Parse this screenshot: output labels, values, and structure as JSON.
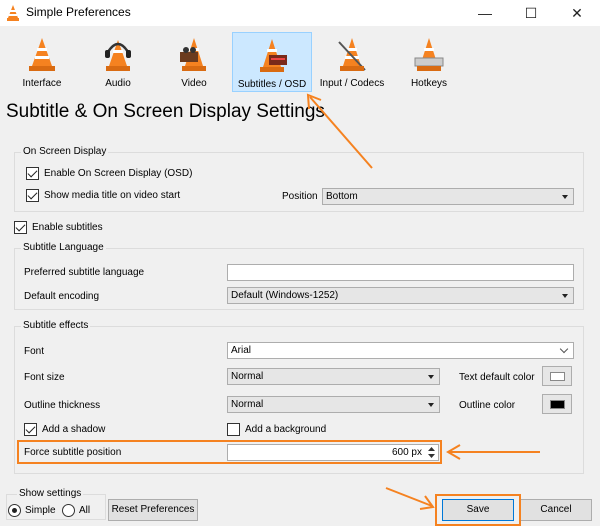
{
  "window": {
    "title": "Simple Preferences",
    "minimize": "—",
    "maximize": "☐",
    "close": "✕"
  },
  "categories": [
    {
      "label": "Interface",
      "icon": "interface-cone-icon"
    },
    {
      "label": "Audio",
      "icon": "headphones-cone-icon"
    },
    {
      "label": "Video",
      "icon": "video-cone-icon"
    },
    {
      "label": "Subtitles / OSD",
      "icon": "subtitles-cone-icon",
      "selected": true
    },
    {
      "label": "Input / Codecs",
      "icon": "input-cone-icon"
    },
    {
      "label": "Hotkeys",
      "icon": "hotkeys-cone-icon"
    }
  ],
  "heading": "Subtitle & On Screen Display Settings",
  "osd": {
    "group_title": "On Screen Display",
    "enable_osd": {
      "label": "Enable On Screen Display (OSD)",
      "checked": true
    },
    "show_title": {
      "label": "Show media title on video start",
      "checked": true
    },
    "position_label": "Position",
    "position_value": "Bottom"
  },
  "enable_subtitles": {
    "label": "Enable subtitles",
    "checked": true
  },
  "language": {
    "group_title": "Subtitle Language",
    "preferred_label": "Preferred subtitle language",
    "preferred_value": "",
    "encoding_label": "Default encoding",
    "encoding_value": "Default (Windows-1252)"
  },
  "effects": {
    "group_title": "Subtitle effects",
    "font_label": "Font",
    "font_value": "Arial",
    "font_size_label": "Font size",
    "font_size_value": "Normal",
    "text_color_label": "Text default color",
    "text_color": "#ffffff",
    "outline_label": "Outline thickness",
    "outline_value": "Normal",
    "outline_color_label": "Outline color",
    "outline_color": "#000000",
    "shadow": {
      "label": "Add a shadow",
      "checked": true
    },
    "background": {
      "label": "Add a background",
      "checked": false
    },
    "force_position_label": "Force subtitle position",
    "force_position_value": "600 px"
  },
  "footer": {
    "show_settings_label": "Show settings",
    "simple_label": "Simple",
    "all_label": "All",
    "reset_label": "Reset Preferences",
    "save_label": "Save",
    "cancel_label": "Cancel"
  },
  "colors": {
    "annotation": "#f58220",
    "selected_tab": "#cce8ff"
  }
}
